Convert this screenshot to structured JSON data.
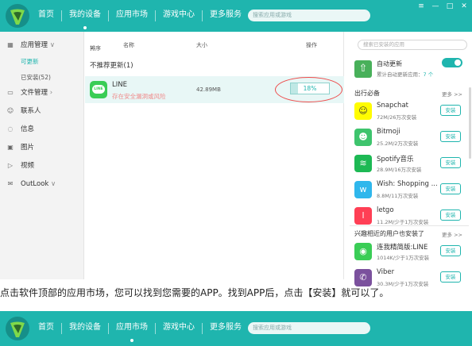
{
  "nav": {
    "items": [
      "首页",
      "我的设备",
      "应用市场",
      "游戏中心",
      "更多服务"
    ],
    "active_index": 1,
    "search_placeholder": "搜索应用或游戏",
    "window_controls": {
      "settings": "≡",
      "minimize": "—",
      "maximize": "□",
      "close": "✕"
    }
  },
  "nav2": {
    "items": [
      "首页",
      "我的设备",
      "应用市场",
      "游戏中心",
      "更多服务"
    ],
    "active_index": 2,
    "search_placeholder": "搜索应用或游戏"
  },
  "sidebar": {
    "app_mgmt": "应用管理",
    "sub_updatable": "可更新",
    "sub_installed": "已安装(52)",
    "file_mgmt": "文件管理",
    "contacts": "联系人",
    "messages": "信息",
    "pictures": "图片",
    "videos": "视频",
    "outlook": "OutLook",
    "chevron": "∨"
  },
  "content": {
    "col_sort": "排序",
    "col_name": "名称",
    "col_size": "大小",
    "col_action": "操作",
    "section_title": "不推荐更新(1)",
    "app": {
      "name": "LINE",
      "icon_text": "LINE",
      "warning": "存在安全漏洞或风险",
      "size": "42.89MB",
      "progress_label": "18%",
      "progress_percent": 18
    }
  },
  "right": {
    "search_placeholder": "搜索已安装的应用",
    "auto_update_title": "自动更新",
    "auto_update_sub": "累计自动更新应用：",
    "auto_update_count": "7 个",
    "auto_update_on": true,
    "section1_title": "出行必备",
    "section1_more": "更多 >>",
    "section2_title": "兴趣相近的用户也安装了",
    "section2_more": "更多 >>",
    "install_label": "安装",
    "apps1": [
      {
        "name": "Snapchat",
        "meta": "72M/26万次安装",
        "icon": "snapchat-icon",
        "color": "#fffc00",
        "glyph": "☺"
      },
      {
        "name": "Bitmoji",
        "meta": "25.2M/2万次安装",
        "icon": "bitmoji-icon",
        "color": "#3ec46d",
        "glyph": "☻"
      },
      {
        "name": "Spotify音乐",
        "meta": "28.9M/16万次安装",
        "icon": "spotify-icon",
        "color": "#1db954",
        "glyph": "≋"
      },
      {
        "name": "Wish: Shopping ...",
        "meta": "8.8M/11万次安装",
        "icon": "wish-icon",
        "color": "#2fb7ec",
        "glyph": "w"
      },
      {
        "name": "letgo",
        "meta": "11.2M/少于1万次安装",
        "icon": "letgo-icon",
        "color": "#ff3f55",
        "glyph": "l"
      }
    ],
    "apps2": [
      {
        "name": "连我精简版:LINE",
        "meta": "1014K/少于1万次安装",
        "icon": "line-lite-icon",
        "color": "#3acd56",
        "glyph": "◉"
      },
      {
        "name": "Viber",
        "meta": "30.3M/少于1万次安装",
        "icon": "viber-icon",
        "color": "#7b519d",
        "glyph": "✆"
      }
    ]
  },
  "caption": "点击软件顶部的应用市场，您可以找到您需要的APP。找到APP后，点击【安装】就可以了。",
  "colors": {
    "accent": "#1fb5ae",
    "warning": "#f08a8a",
    "highlight": "#ee4a4a"
  }
}
